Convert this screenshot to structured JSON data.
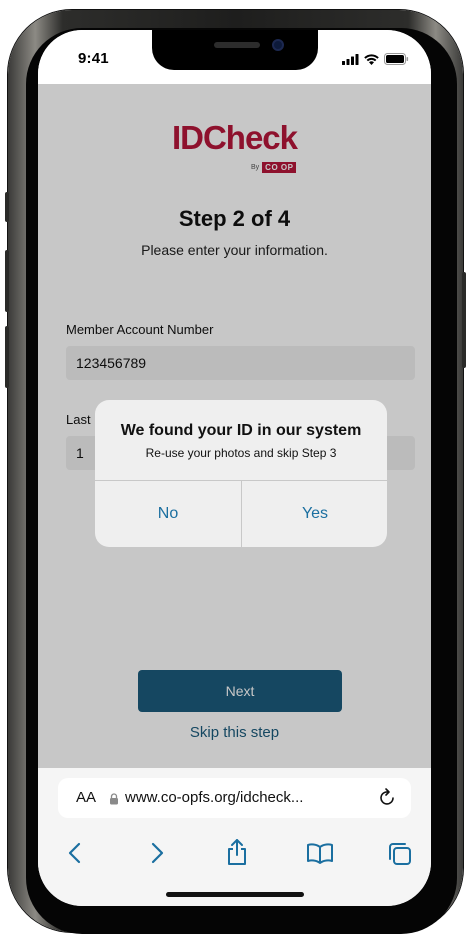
{
  "status_bar": {
    "time": "9:41"
  },
  "page": {
    "logo_text": "IDCheck",
    "byline_by": "By",
    "byline_brand": "CO OP",
    "step_title": "Step 2 of 4",
    "step_subtitle": "Please enter your information.",
    "fields": [
      {
        "label": "Member Account Number",
        "value": "123456789"
      },
      {
        "label": "Last",
        "value": "1"
      }
    ],
    "next_button": "Next",
    "skip_link": "Skip this step"
  },
  "dialog": {
    "title": "We found your ID in our system",
    "message": "Re-use your photos and skip Step 3",
    "no_label": "No",
    "yes_label": "Yes"
  },
  "safari": {
    "aa_label": "AA",
    "url": "www.co-opfs.org/idcheck...",
    "toolbar_icons": [
      "back-icon",
      "forward-icon",
      "share-icon",
      "bookmarks-icon",
      "tabs-icon"
    ]
  },
  "colors": {
    "brand_red": "#b6163a",
    "primary_blue": "#1b5c7d",
    "link_blue": "#1b6fa0"
  }
}
